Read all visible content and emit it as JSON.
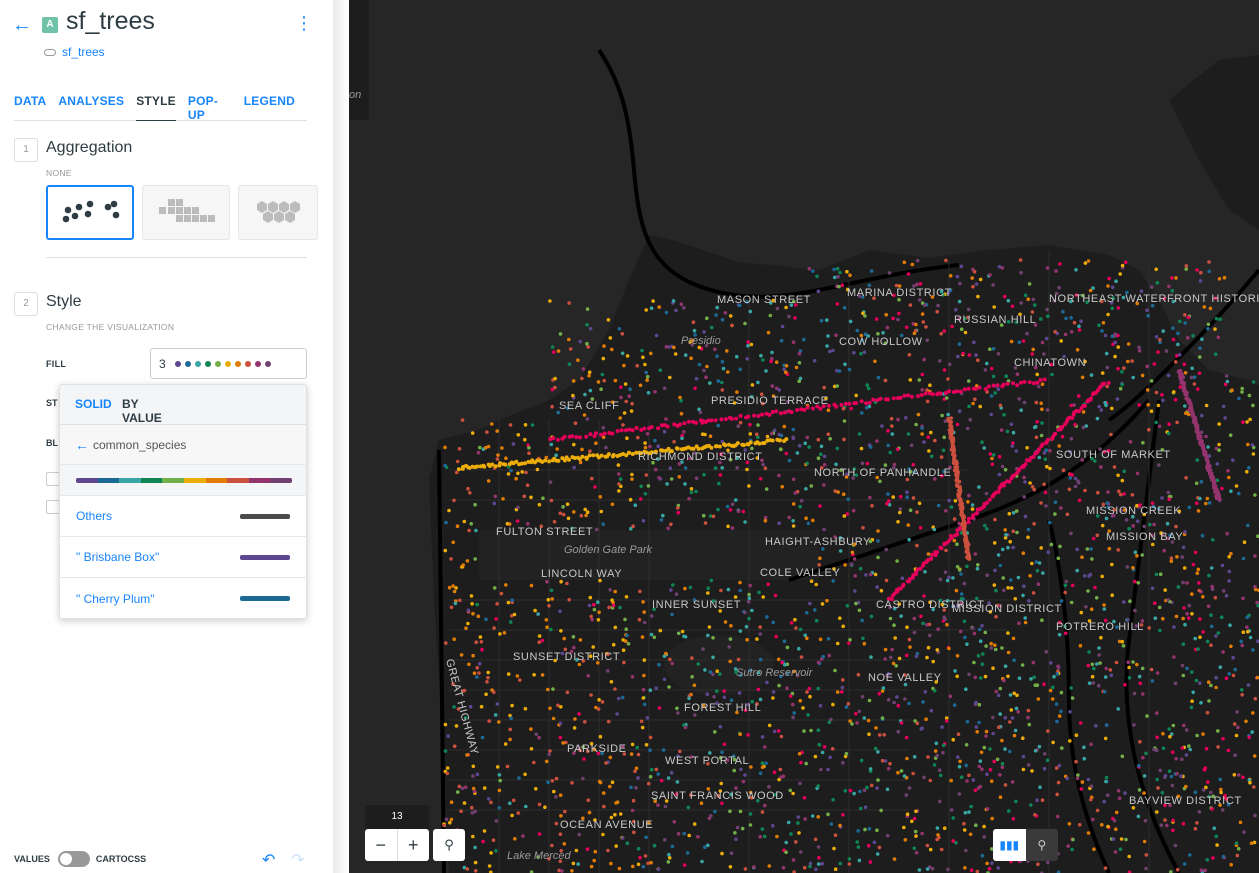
{
  "layer": {
    "badge": "A",
    "title": "sf_trees",
    "source": "sf_trees"
  },
  "tabs": [
    "DATA",
    "ANALYSES",
    "STYLE",
    "POP-UP",
    "LEGEND"
  ],
  "active_tab": "STYLE",
  "aggregation": {
    "step": "1",
    "title": "Aggregation",
    "subtitle": "NONE",
    "options": [
      "points",
      "squares",
      "hexagons"
    ]
  },
  "style": {
    "step": "2",
    "title": "Style",
    "subtitle": "CHANGE THE VISUALIZATION",
    "fill_label": "FILL",
    "fill_count": "3",
    "stroke_label": "ST",
    "blending_label": "BL",
    "fill_dots": [
      "#5f4690",
      "#1d6996",
      "#38a6a5",
      "#0f8554",
      "#73af48",
      "#edad08",
      "#e17c05",
      "#cc503e",
      "#94346e",
      "#6f4070"
    ]
  },
  "popup": {
    "tab_solid": "SOLID",
    "tab_by_value": "BY VALUE",
    "column": "common_species",
    "ramp": [
      "#5f4690",
      "#1d6996",
      "#38a6a5",
      "#0f8554",
      "#73af48",
      "#edad08",
      "#e17c05",
      "#cc503e",
      "#94346e",
      "#6f4070"
    ],
    "categories": [
      {
        "label": "Others",
        "color": "#4b4b4b"
      },
      {
        "label": "\" Brisbane Box\"",
        "color": "#5f4690"
      },
      {
        "label": "\" Cherry Plum\"",
        "color": "#1d6996"
      }
    ]
  },
  "bottom": {
    "values_label": "VALUES",
    "cartocss_label": "CARTOCSS"
  },
  "map": {
    "zoom": "13",
    "labels": [
      "MASON STREET",
      "Presidio",
      "MARINA DISTRICT",
      "RUSSIAN HILL",
      "NORTHEAST WATERFRONT HISTORIC DISTRICT",
      "COW HOLLOW",
      "CHINATOWN",
      "PRESIDIO TERRACE",
      "SEA CLIFF",
      "RICHMOND DISTRICT",
      "NORTH OF PANHANDLE",
      "SOUTH OF MARKET",
      "MISSION CREEK",
      "MISSION BAY",
      "FULTON STREET",
      "Golden Gate Park",
      "HAIGHT-ASHBURY",
      "LINCOLN WAY",
      "COLE VALLEY",
      "INNER SUNSET",
      "CASTRO DISTRICT",
      "MISSION DISTRICT",
      "POTRERO HILL",
      "SUNSET DISTRICT",
      "Sutro Reservoir",
      "NOE VALLEY",
      "GREAT HIGHWAY",
      "FOREST HILL",
      "PARKSIDE",
      "WEST PORTAL",
      "SAINT FRANCIS WOOD",
      "OCEAN AVENUE",
      "BAYVIEW DISTRICT",
      "Lake Merced",
      "on"
    ]
  }
}
